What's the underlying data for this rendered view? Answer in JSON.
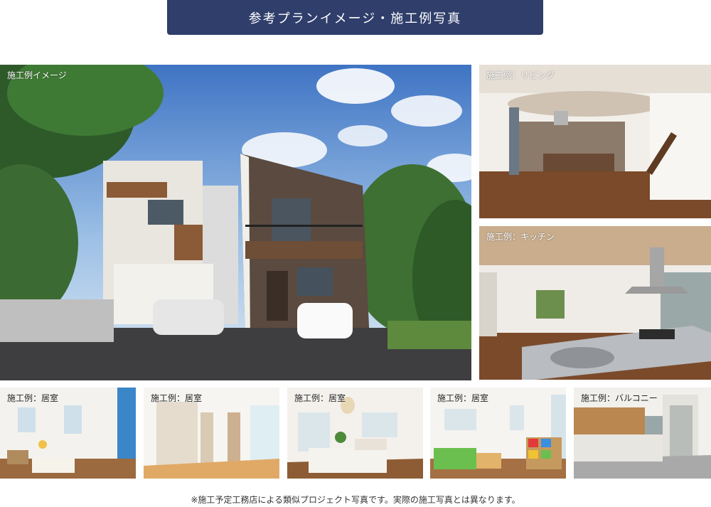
{
  "header": {
    "title": "参考プランイメージ・施工例写真"
  },
  "photos": {
    "exterior": {
      "caption": "施工例イメージ"
    },
    "living": {
      "caption": "施工例：リビング"
    },
    "kitchen": {
      "caption": "施工例：キッチン"
    },
    "room1": {
      "caption": "施工例：居室"
    },
    "room2": {
      "caption": "施工例：居室"
    },
    "room3": {
      "caption": "施工例：居室"
    },
    "room4": {
      "caption": "施工例：居室"
    },
    "balcony": {
      "caption": "施工例：バルコニー"
    }
  },
  "footer": {
    "note": "※施工予定工務店による類似プロジェクト写真です。実際の施工写真とは異なります。"
  },
  "colors": {
    "header_bg": "#2f3e6b",
    "header_text": "#ffffff"
  }
}
